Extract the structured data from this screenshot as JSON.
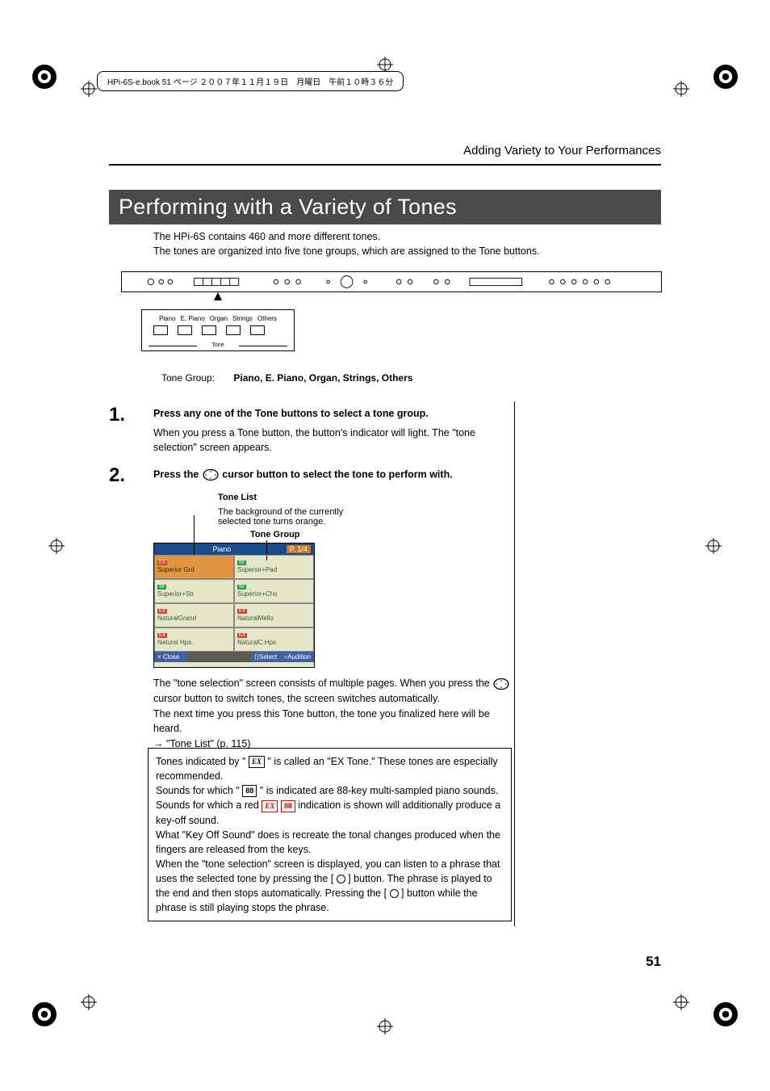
{
  "meta": {
    "page_header": "HPi-6S-e.book  51 ページ  ２００７年１１月１９日　月曜日　午前１０時３６分",
    "chapter_header": "Adding Variety to Your Performances",
    "page_num": "51"
  },
  "section_title": "Performing with a Variety of Tones",
  "intro": {
    "line1": "The HPi-6S contains 460 and more different tones.",
    "line2": "The tones are organized into five tone groups, which are assigned to the Tone buttons."
  },
  "tone_btns": {
    "labels": [
      "Piano",
      "E. Piano",
      "Organ",
      "Strings",
      "Others"
    ],
    "box_label": "Tone"
  },
  "tone_group_line": {
    "label": "Tone Group:",
    "value": "Piano, E. Piano, Organ, Strings, Others"
  },
  "steps": {
    "s1": {
      "num": "1.",
      "title": "Press any one of the Tone buttons to select a tone group.",
      "body": "When you press a Tone button, the button's indicator will light. The \"tone selection\" screen appears."
    },
    "s2": {
      "num": "2.",
      "title_pre": "Press the ",
      "title_post": " cursor button to select the tone to perform with."
    }
  },
  "tone_list_diagram": {
    "title": "Tone List",
    "bg_desc": "The background of the currently selected tone turns orange.",
    "group_label": "Tone Group",
    "header_left": "Piano",
    "header_right": "P. 1/4",
    "grid": [
      {
        "tag_class": "ex",
        "tag": "EX",
        "name": "Superior Grd",
        "selected": true
      },
      {
        "tag_class": "m88",
        "tag": "88",
        "name": "Superior+Pad"
      },
      {
        "tag_class": "m88",
        "tag": "88",
        "name": "Superior+Str"
      },
      {
        "tag_class": "m88",
        "tag": "88",
        "name": "Superior+Cho"
      },
      {
        "tag_class": "ex",
        "tag": "EX",
        "name": "NaturalGrand"
      },
      {
        "tag_class": "ex",
        "tag": "EX",
        "name": "NaturalMello"
      },
      {
        "tag_class": "ex",
        "tag": "EX",
        "name": "Natural Hps."
      },
      {
        "tag_class": "ex",
        "tag": "EX",
        "name": "NaturalC.Hps"
      }
    ],
    "footer": {
      "close": "× Close",
      "select": "⟨⟩Select",
      "audition": "○Audition"
    }
  },
  "after_screen": {
    "p1a": "The \"tone selection\" screen consists of multiple pages. When you press the ",
    "p1b": " cursor button to switch tones, the screen switches automatically.",
    "p2": "The next time you press this Tone button, the tone you finalized here will be heard.",
    "ref": "→ \"Tone List\" (p. 115)"
  },
  "note_box": {
    "l1a": "Tones indicated by \" ",
    "l1b": " \" is called an \"EX Tone.\" These tones are especially recommended.",
    "l2a": "Sounds for which \" ",
    "l2b": " \" is indicated are 88-key multi-sampled piano sounds.",
    "l3a": "Sounds for which a red ",
    "l3b": " indication is shown will additionally produce a key-off sound.",
    "l4": "What \"Key Off Sound\" does is recreate the tonal changes produced when the fingers are released from the keys.",
    "l5a": "When the \"tone selection\" screen is displayed, you can listen to a phrase that uses the selected tone by pressing the [ ",
    "l5b": " ] button. The phrase is played to the end and then stops automatically. Pressing the [ ",
    "l5c": " ] button while the phrase is still playing stops the phrase."
  },
  "badges": {
    "ex": "EX",
    "m88": "88"
  }
}
